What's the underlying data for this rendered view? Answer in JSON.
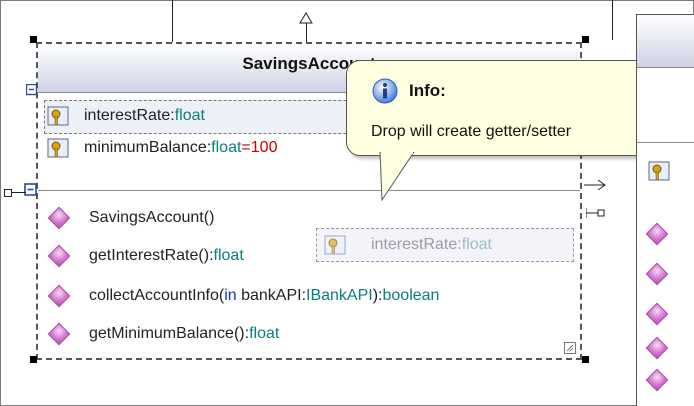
{
  "class": {
    "title": "SavingsAccount",
    "attributes": [
      {
        "name": "interestRate",
        "sep": ":",
        "type": "float",
        "default": ""
      },
      {
        "name": "minimumBalance",
        "sep": ":",
        "type": "float",
        "eq": "=",
        "default": "100"
      }
    ],
    "operations": [
      {
        "name": "SavingsAccount()",
        "sep": "",
        "type": ""
      },
      {
        "name": "getInterestRate()",
        "sep": ":",
        "type": "float"
      },
      {
        "name": "collectAccountInfo(",
        "kw": "in",
        "param": " bankAPI:",
        "ptype": "IBankAPI",
        "close": "):",
        "type": "boolean"
      },
      {
        "name": "getMinimumBalance()",
        "sep": ":",
        "type": "float"
      }
    ]
  },
  "tooltip": {
    "title": "Info:",
    "body": "Drop will create getter/setter"
  },
  "drag_ghost": {
    "name": "interestRate",
    "sep": ":",
    "type": "float"
  },
  "colors": {
    "type_color": "#0a7e7e",
    "keyword_color": "#1a2ec4",
    "default_color": "#cc0000",
    "operation_icon": "#d277d0",
    "tooltip_bg": "#ffffe1"
  },
  "icons": [
    "key-field-icon",
    "operation-diamond-icon",
    "info-icon",
    "collapse-icon",
    "arrow-icon",
    "resize-grip-icon"
  ]
}
